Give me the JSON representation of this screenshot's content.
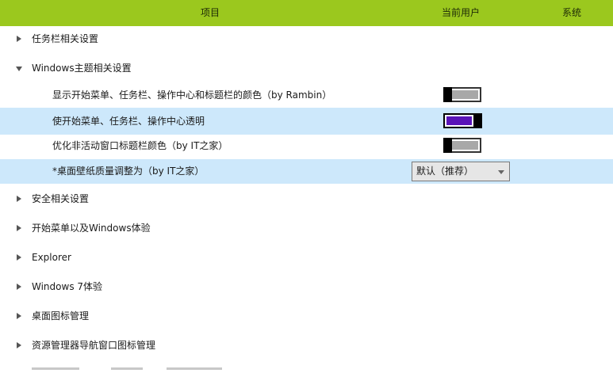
{
  "header": {
    "col_item": "项目",
    "col_current_user": "当前用户",
    "col_system": "系统"
  },
  "groups": {
    "taskbar": {
      "label": "任务栏相关设置",
      "expanded": false
    },
    "windows_theme": {
      "label": "Windows主题相关设置",
      "expanded": true
    },
    "security": {
      "label": "安全相关设置",
      "expanded": false
    },
    "start_menu": {
      "label": "开始菜单以及Windows体验",
      "expanded": false
    },
    "explorer": {
      "label": "Explorer",
      "expanded": false
    },
    "win7": {
      "label": "Windows 7体验",
      "expanded": false
    },
    "desktop_icons": {
      "label": "桌面图标管理",
      "expanded": false
    },
    "nav_icons": {
      "label": "资源管理器导航窗口图标管理",
      "expanded": false
    }
  },
  "theme_items": {
    "show_color": {
      "label": "显示开始菜单、任务栏、操作中心和标题栏的颜色（by Rambin）",
      "toggle": "off"
    },
    "transparent": {
      "label": "使开始菜单、任务栏、操作中心透明",
      "toggle": "on",
      "selected": true
    },
    "inactive_title": {
      "label": "优化非活动窗口标题栏颜色（by IT之家）",
      "toggle": "off"
    },
    "wallpaper_quality": {
      "label": "*桌面壁纸质量调整为（by IT之家）",
      "select_value": "默认（推荐）",
      "selected": true
    }
  },
  "colors": {
    "header_bg": "#9bc81e",
    "selected_row_bg": "#cde8fb",
    "toggle_on_fill": "#5a14b8",
    "toggle_off_fill": "#a8a8a8"
  }
}
